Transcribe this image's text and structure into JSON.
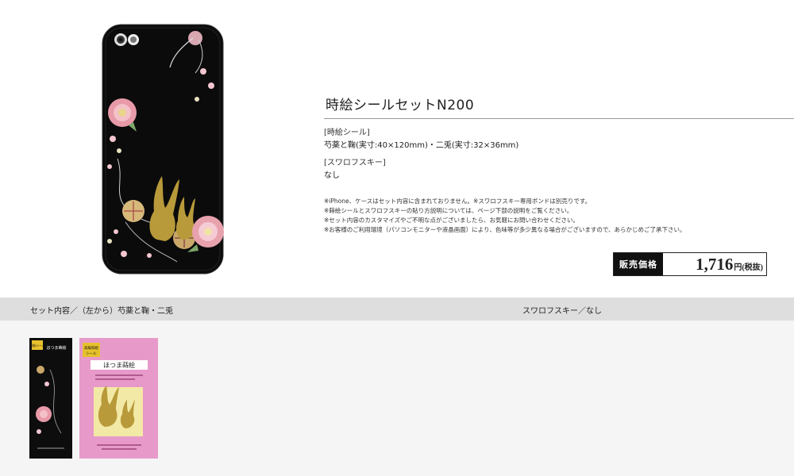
{
  "product": {
    "title": "時絵シールセットN200",
    "section1_label": "[時絵シール]",
    "section1_value": "芍薬と鞠(実寸:40×120mm)・二兎(実寸:32×36mm)",
    "section2_label": "[スワロフスキー]",
    "section2_value": "なし",
    "notes": [
      "※iPhone、ケースはセット内容に含まれておりません。※スワロフスキー専用ボンドは別売りです。",
      "※蒔絵シールとスワロフスキーの貼り方説明については、ページ下部の説明をご覧ください。",
      "※セット内容のカスタマイズやご不明な点がございましたら、お気軽にお問い合わせください。",
      "※お客様のご利用環境（パソコンモニターや液晶画面）により、色味等が多少異なる場合がございますので、あらかじめご了承下さい。"
    ],
    "price_label": "販売価格",
    "price_value": "1,716",
    "price_unit": "円(税抜)"
  },
  "set_bar": {
    "left_label": "セット内容／（左から）芍薬と鞠・二兎",
    "right_label": "スワロフスキー／なし"
  },
  "packages": {
    "left": {
      "tag": "蒔絵シール",
      "brand": "ほつま蒔絵"
    },
    "right": {
      "tag_top": "高級蒔絵",
      "tag_bottom": "シール",
      "brand": "ほつま蒔絵"
    }
  },
  "colors": {
    "case": "#0b0b0b",
    "gold": "#b89a3a",
    "pink_pack": "#e79ac9",
    "bar": "#dedede"
  }
}
